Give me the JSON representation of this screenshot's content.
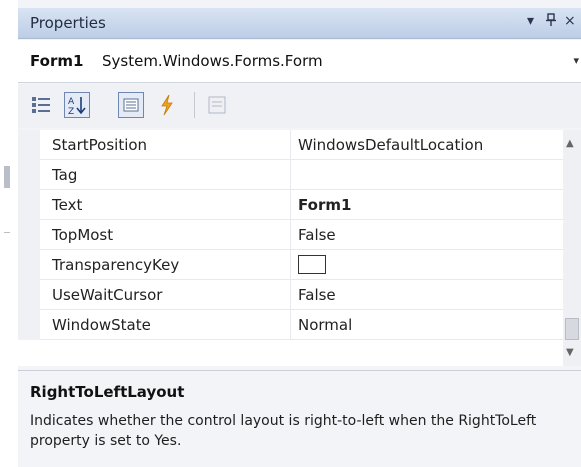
{
  "panel": {
    "title": "Properties",
    "buttons": {
      "dropdown": "▾",
      "pin": "⌷",
      "close": "×"
    }
  },
  "object": {
    "name": "Form1",
    "type": "System.Windows.Forms.Form",
    "arrow": "▾"
  },
  "toolbar": {
    "buttons": [
      "categorized",
      "alphabetical",
      "properties",
      "events",
      "property-pages"
    ],
    "active": [
      "alphabetical",
      "properties"
    ]
  },
  "grid": {
    "rows": [
      {
        "name": "StartPosition",
        "value": "WindowsDefaultLocation",
        "bold": false
      },
      {
        "name": "Tag",
        "value": "",
        "bold": false
      },
      {
        "name": "Text",
        "value": "Form1",
        "bold": true
      },
      {
        "name": "TopMost",
        "value": "False",
        "bold": false
      },
      {
        "name": "TransparencyKey",
        "value": "",
        "bold": false,
        "swatch": true
      },
      {
        "name": "UseWaitCursor",
        "value": "False",
        "bold": false
      },
      {
        "name": "WindowState",
        "value": "Normal",
        "bold": false
      }
    ]
  },
  "description": {
    "title": "RightToLeftLayout",
    "body": "Indicates whether the control layout is right-to-left when the RightToLeft property is set to Yes."
  },
  "colors": {
    "title_bar": "#c8d7ec",
    "swatch": "#ffffff"
  }
}
